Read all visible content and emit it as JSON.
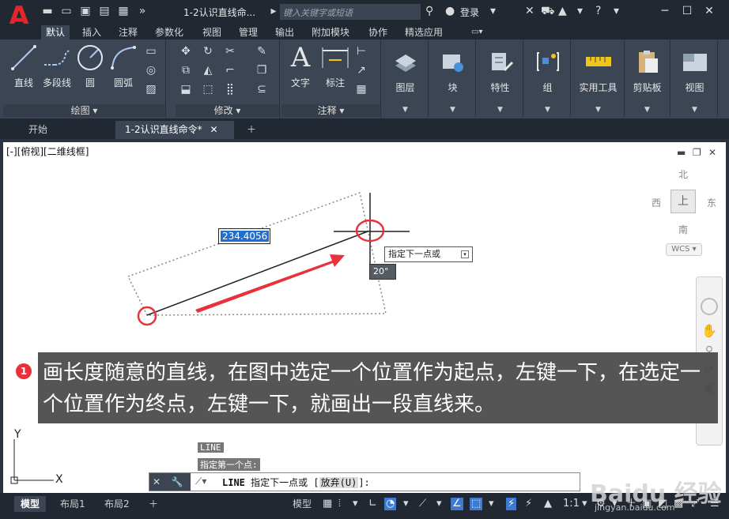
{
  "app": {
    "logo_letter": "A",
    "doc_title": "1-2认识直线命...",
    "search_placeholder": "键入关键字或短语",
    "login": "登录"
  },
  "ribbon_tabs": [
    "默认",
    "插入",
    "注释",
    "参数化",
    "视图",
    "管理",
    "输出",
    "附加模块",
    "协作",
    "精选应用"
  ],
  "draw_panel": {
    "title": "绘图",
    "tools": [
      "直线",
      "多段线",
      "圆",
      "圆弧"
    ]
  },
  "modify_panel": {
    "title": "修改"
  },
  "annotate_panel": {
    "title": "注释",
    "tools": [
      "文字",
      "标注"
    ]
  },
  "big_panels": [
    "图层",
    "块",
    "特性",
    "组",
    "实用工具",
    "剪贴板",
    "视图"
  ],
  "doc_tabs": [
    "开始",
    "1-2认识直线命令*"
  ],
  "viewport": {
    "label": "[-][俯视][二维线框]",
    "compass": {
      "north": "北",
      "south": "南",
      "east": "东",
      "west": "西",
      "top": "上"
    },
    "wcs": "WCS"
  },
  "drawing": {
    "length_input": "234.4056",
    "tooltip": "指定下一点或",
    "angle": "20°"
  },
  "annotation": {
    "number": "1",
    "text": "画长度随意的直线，在图中选定一个位置作为起点，左键一下，在选定一个位置作为终点，左键一下，就画出一段直线来。"
  },
  "command": {
    "history": [
      "LINE",
      "指定第一个点:"
    ],
    "prompt_cmd": "LINE",
    "prompt_text": "指定下一点或",
    "option_bracket_open": "[",
    "option": "放弃(U)",
    "option_bracket_close": "]:"
  },
  "axis": {
    "x": "X",
    "y": "Y"
  },
  "layout_tabs": [
    "模型",
    "布局1",
    "布局2"
  ],
  "status": {
    "model": "模型",
    "scale": "1:1"
  },
  "watermark": {
    "main": "Baidu 经验",
    "sub": "jingyan.baidu.com"
  }
}
